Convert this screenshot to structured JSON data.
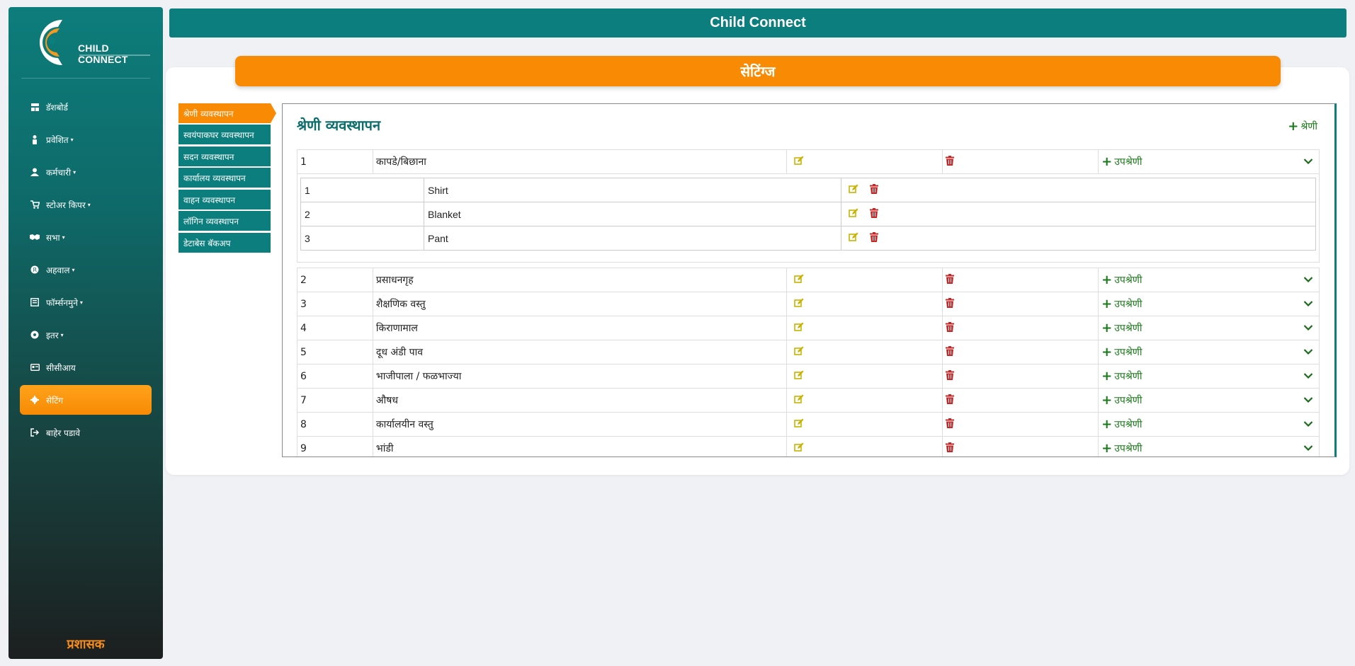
{
  "app": {
    "title": "Child Connect",
    "logo_text": "CHILD CONNECT",
    "admin_label": "प्रशासक"
  },
  "sidebar": {
    "items": [
      {
        "label": "डॅशबोर्ड",
        "icon": "dashboard-icon",
        "caret": ""
      },
      {
        "label": "प्रवेशित",
        "icon": "person-icon",
        "caret": "▾"
      },
      {
        "label": "कर्मचारी",
        "icon": "user-icon",
        "caret": "▾"
      },
      {
        "label": "स्टोअर किपर",
        "icon": "cart-icon",
        "caret": "▾"
      },
      {
        "label": "सभा",
        "icon": "handshake-icon",
        "caret": "▾"
      },
      {
        "label": "अहवाल",
        "icon": "report-icon",
        "caret": "▾"
      },
      {
        "label": "फॉर्म्सनमुने",
        "icon": "form-icon",
        "caret": "▾"
      },
      {
        "label": "इतर",
        "icon": "other-icon",
        "caret": "▾"
      },
      {
        "label": "सीसीआय",
        "icon": "id-card-icon",
        "caret": ""
      },
      {
        "label": "सेटिंग",
        "icon": "gear-icon",
        "caret": "",
        "active": true
      },
      {
        "label": "बाहेर पडावे",
        "icon": "logout-icon",
        "caret": ""
      }
    ]
  },
  "settings": {
    "banner": "सेटिंग्ज",
    "subnav": [
      "श्रेणी व्यवस्थापन",
      "स्वयंपाकघर व्यवस्थापन",
      "सदन व्यवस्थापन",
      "कार्यालय व्यवस्थापन",
      "वाहन व्यवस्थापन",
      "लॉगिन व्यवस्थापन",
      "डेटाबेस बॅकअप"
    ]
  },
  "panel": {
    "title": "श्रेणी व्यवस्थापन",
    "add_category_label": "श्रेणी",
    "subcategory_label": "उपश्रेणी",
    "categories": [
      {
        "no": "1",
        "name": "कापडे/बिछाना"
      },
      {
        "no": "2",
        "name": "प्रसाधनगृह"
      },
      {
        "no": "3",
        "name": "शैक्षणिक वस्तु"
      },
      {
        "no": "4",
        "name": "किराणामाल"
      },
      {
        "no": "5",
        "name": "दूध अंडी पाव"
      },
      {
        "no": "6",
        "name": "भाजीपाला / फळभाज्या"
      },
      {
        "no": "7",
        "name": "औषध"
      },
      {
        "no": "8",
        "name": "कार्यालयीन वस्तु"
      },
      {
        "no": "9",
        "name": "भांडी"
      }
    ],
    "subcategories": [
      {
        "no": "1",
        "name": "Shirt"
      },
      {
        "no": "2",
        "name": "Blanket"
      },
      {
        "no": "3",
        "name": "Pant"
      }
    ]
  },
  "colors": {
    "teal": "#0b7e7d",
    "orange": "#f98a04",
    "edit": "#c8b400",
    "delete": "#c62828",
    "add": "#1a7a1a"
  }
}
